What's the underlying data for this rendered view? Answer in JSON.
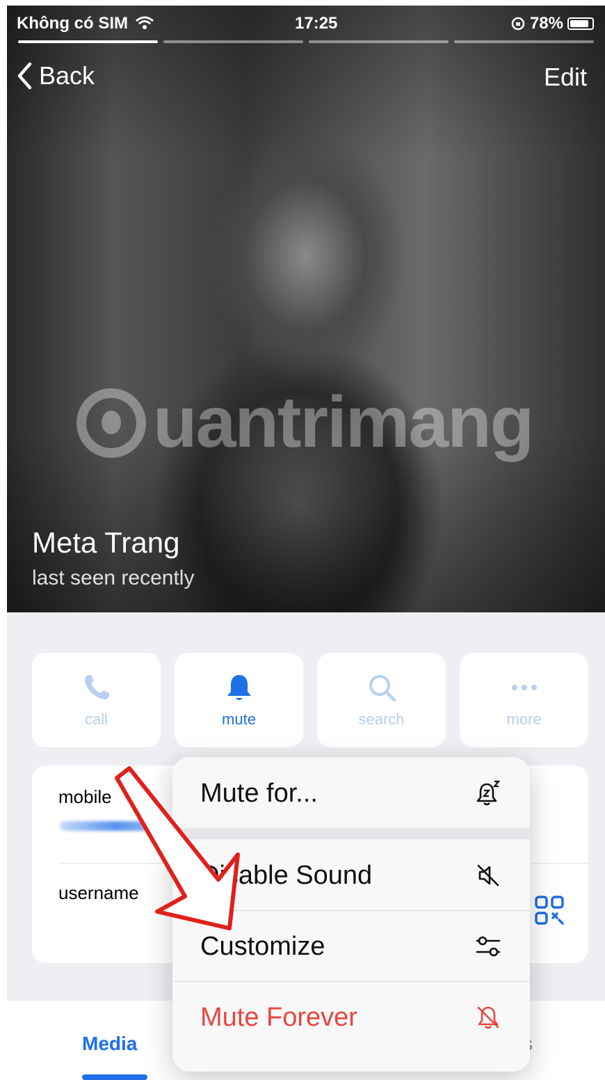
{
  "status_bar": {
    "carrier": "Không có SIM",
    "time": "17:25",
    "battery": "78%"
  },
  "nav": {
    "back_label": "Back",
    "edit_label": "Edit"
  },
  "profile": {
    "name": "Meta Trang",
    "status": "last seen recently"
  },
  "watermark": "uantrimang",
  "actions": [
    {
      "label": "call",
      "icon": "phone-icon"
    },
    {
      "label": "mute",
      "icon": "bell-icon"
    },
    {
      "label": "search",
      "icon": "search-icon"
    },
    {
      "label": "more",
      "icon": "ellipsis-icon"
    }
  ],
  "info": {
    "mobile_label": "mobile",
    "username_label": "username"
  },
  "tabs": {
    "media_label": "Media"
  },
  "mute_menu": [
    {
      "label": "Mute for...",
      "icon": "bell-snooze-icon"
    },
    {
      "label": "Disable Sound",
      "icon": "speaker-off-icon"
    },
    {
      "label": "Customize",
      "icon": "sliders-icon"
    },
    {
      "label": "Mute Forever",
      "icon": "bell-slash-icon"
    }
  ],
  "colors": {
    "accent": "#1e6fe8",
    "danger": "#e8463f",
    "annotation": "#e0201b"
  }
}
